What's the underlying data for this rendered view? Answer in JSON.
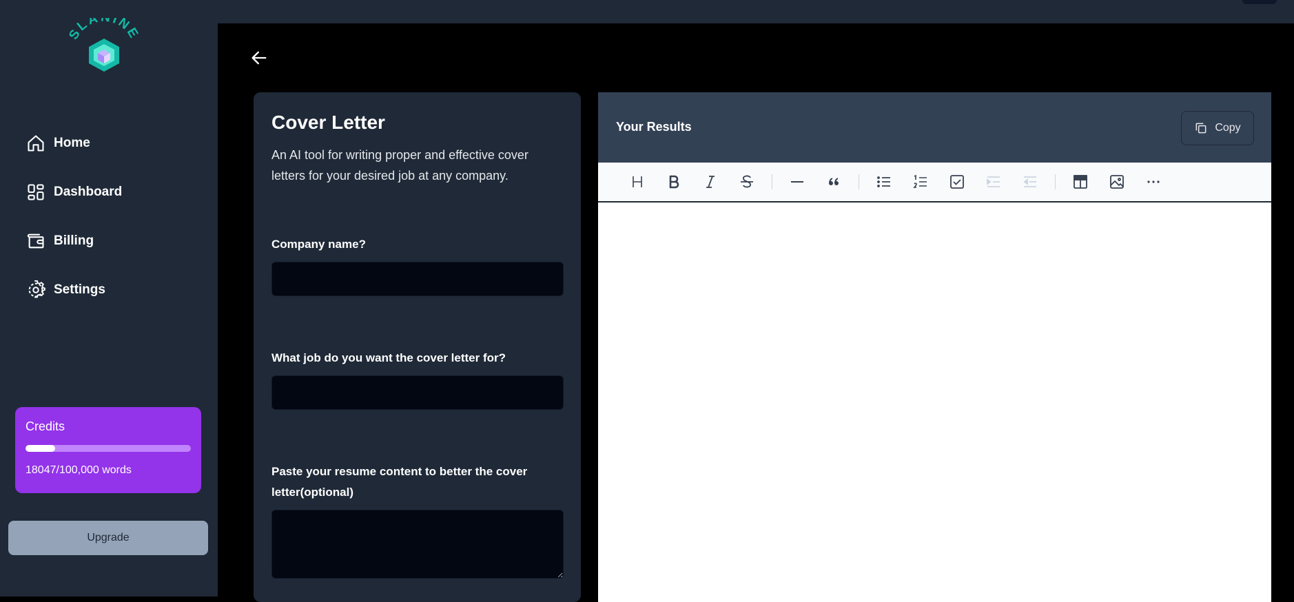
{
  "app": {
    "logo_text": "SLANINE"
  },
  "sidebar": {
    "items": [
      {
        "label": "Home",
        "icon": "home-icon"
      },
      {
        "label": "Dashboard",
        "icon": "dashboard-icon"
      },
      {
        "label": "Billing",
        "icon": "wallet-icon"
      },
      {
        "label": "Settings",
        "icon": "gear-icon"
      }
    ],
    "credits": {
      "title": "Credits",
      "used": 18047,
      "total": 100000,
      "fraction": 0.18,
      "text": "18047/100,000 words"
    },
    "upgrade_label": "Upgrade"
  },
  "form": {
    "title": "Cover Letter",
    "description": "An AI tool for writing proper and effective cover letters for your desired job at any company.",
    "fields": [
      {
        "label": "Company name?",
        "value": "",
        "type": "input"
      },
      {
        "label": "What job do you want the cover letter for?",
        "value": "",
        "type": "input"
      },
      {
        "label": "Paste your resume content to better the cover letter(optional)",
        "value": "",
        "type": "textarea"
      }
    ]
  },
  "results": {
    "title": "Your Results",
    "copy_label": "Copy",
    "toolbar": [
      "heading-icon",
      "bold-icon",
      "italic-icon",
      "strikethrough-icon",
      "horizontal-rule-icon",
      "quote-icon",
      "bullet-list-icon",
      "ordered-list-icon",
      "task-list-icon",
      "indent-icon",
      "outdent-icon",
      "table-icon",
      "image-icon",
      "more-icon"
    ]
  },
  "colors": {
    "sidebar_bg": "#1f2937",
    "credits_bg": "#9333ea",
    "upgrade_bg": "#94a3b8",
    "results_header_bg": "#334155",
    "logo_teal": "#14b8a6"
  }
}
